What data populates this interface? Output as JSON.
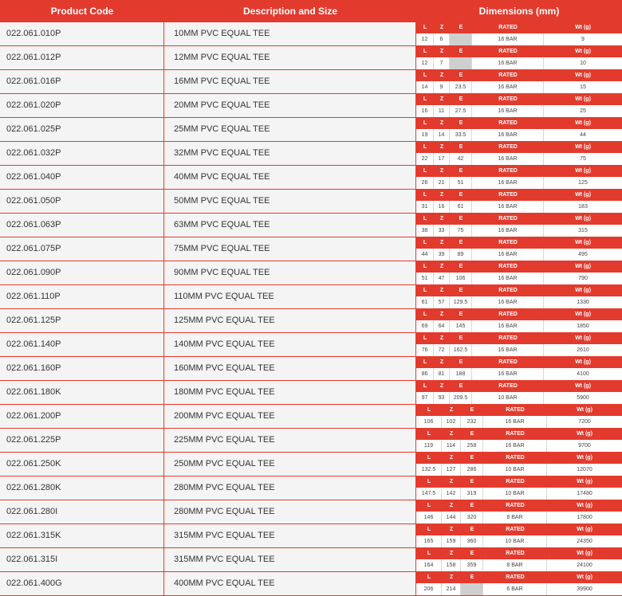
{
  "header": {
    "product_code": "Product Code",
    "description": "Description and Size",
    "dimensions": "Dimensions (mm)"
  },
  "subheader": {
    "l": "L",
    "z": "Z",
    "e": "E",
    "rated": "RATED",
    "wt": "Wt (g)"
  },
  "rows": [
    {
      "code": "022.061.010P",
      "desc": "10MM PVC EQUAL TEE",
      "l": "12",
      "z": "6",
      "e": "",
      "rated": "16 BAR",
      "wt": "9"
    },
    {
      "code": "022.061.012P",
      "desc": "12MM PVC EQUAL TEE",
      "l": "12",
      "z": "7",
      "e": "",
      "rated": "16 BAR",
      "wt": "10"
    },
    {
      "code": "022.061.016P",
      "desc": "16MM PVC EQUAL TEE",
      "l": "14",
      "z": "9",
      "e": "23.5",
      "rated": "16 BAR",
      "wt": "15"
    },
    {
      "code": "022.061.020P",
      "desc": "20MM PVC EQUAL TEE",
      "l": "16",
      "z": "11",
      "e": "27.5",
      "rated": "16 BAR",
      "wt": "25"
    },
    {
      "code": "022.061.025P",
      "desc": "25MM PVC EQUAL TEE",
      "l": "19",
      "z": "14",
      "e": "33.5",
      "rated": "16 BAR",
      "wt": "44"
    },
    {
      "code": "022.061.032P",
      "desc": "32MM PVC EQUAL TEE",
      "l": "22",
      "z": "17",
      "e": "42",
      "rated": "16 BAR",
      "wt": "75"
    },
    {
      "code": "022.061.040P",
      "desc": "40MM PVC EQUAL TEE",
      "l": "26",
      "z": "21",
      "e": "51",
      "rated": "16 BAR",
      "wt": "125"
    },
    {
      "code": "022.061.050P",
      "desc": "50MM PVC EQUAL TEE",
      "l": "31",
      "z": "16",
      "e": "61",
      "rated": "16 BAR",
      "wt": "183"
    },
    {
      "code": "022.061.063P",
      "desc": "63MM PVC EQUAL TEE",
      "l": "38",
      "z": "33",
      "e": "75",
      "rated": "16 BAR",
      "wt": "315"
    },
    {
      "code": "022.061.075P",
      "desc": "75MM PVC EQUAL TEE",
      "l": "44",
      "z": "39",
      "e": "89",
      "rated": "16 BAR",
      "wt": "495"
    },
    {
      "code": "022.061.090P",
      "desc": "90MM PVC EQUAL TEE",
      "l": "51",
      "z": "47",
      "e": "106",
      "rated": "16 BAR",
      "wt": "790"
    },
    {
      "code": "022.061.110P",
      "desc": "110MM PVC EQUAL TEE",
      "l": "61",
      "z": "57",
      "e": "129.5",
      "rated": "16 BAR",
      "wt": "1330"
    },
    {
      "code": "022.061.125P",
      "desc": "125MM PVC EQUAL TEE",
      "l": "69",
      "z": "64",
      "e": "145",
      "rated": "16 BAR",
      "wt": "1850"
    },
    {
      "code": "022.061.140P",
      "desc": "140MM PVC EQUAL TEE",
      "l": "76",
      "z": "72",
      "e": "162.5",
      "rated": "16 BAR",
      "wt": "2610"
    },
    {
      "code": "022.061.160P",
      "desc": "160MM PVC EQUAL TEE",
      "l": "86",
      "z": "81",
      "e": "188",
      "rated": "16 BAR",
      "wt": "4100"
    },
    {
      "code": "022.061.180K",
      "desc": "180MM PVC EQUAL TEE",
      "l": "97",
      "z": "93",
      "e": "209.5",
      "rated": "10 BAR",
      "wt": "5900"
    },
    {
      "code": "022.061.200P",
      "desc": "200MM PVC EQUAL TEE",
      "l": "106",
      "z": "102",
      "e": "232",
      "rated": "16 BAR",
      "wt": "7200"
    },
    {
      "code": "022.061.225P",
      "desc": "225MM PVC EQUAL TEE",
      "l": "119",
      "z": "114",
      "e": "258",
      "rated": "16 BAR",
      "wt": "9700"
    },
    {
      "code": "022.061.250K",
      "desc": "250MM PVC EQUAL TEE",
      "l": "132.5",
      "z": "127",
      "e": "286",
      "rated": "10 BAR",
      "wt": "12070"
    },
    {
      "code": "022.061.280K",
      "desc": "280MM PVC EQUAL TEE",
      "l": "147.5",
      "z": "142",
      "e": "319",
      "rated": "10 BAR",
      "wt": "17480"
    },
    {
      "code": "022.061.280I",
      "desc": "280MM PVC EQUAL TEE",
      "l": "146",
      "z": "144",
      "e": "320",
      "rated": "8 BAR",
      "wt": "17800"
    },
    {
      "code": "022.061.315K",
      "desc": "315MM PVC EQUAL TEE",
      "l": "165",
      "z": "159",
      "e": "360",
      "rated": "10 BAR",
      "wt": "24350"
    },
    {
      "code": "022.061.315I",
      "desc": "315MM PVC EQUAL TEE",
      "l": "164",
      "z": "158",
      "e": "359",
      "rated": "8 BAR",
      "wt": "24100"
    },
    {
      "code": "022.061.400G",
      "desc": "400MM PVC EQUAL TEE",
      "l": "206",
      "z": "214",
      "e": "",
      "rated": "6 BAR",
      "wt": "39900"
    }
  ],
  "colors": {
    "accent": "#e23b2e",
    "row_bg": "#f4f4f4",
    "blank_cell": "#cfcfcf"
  }
}
